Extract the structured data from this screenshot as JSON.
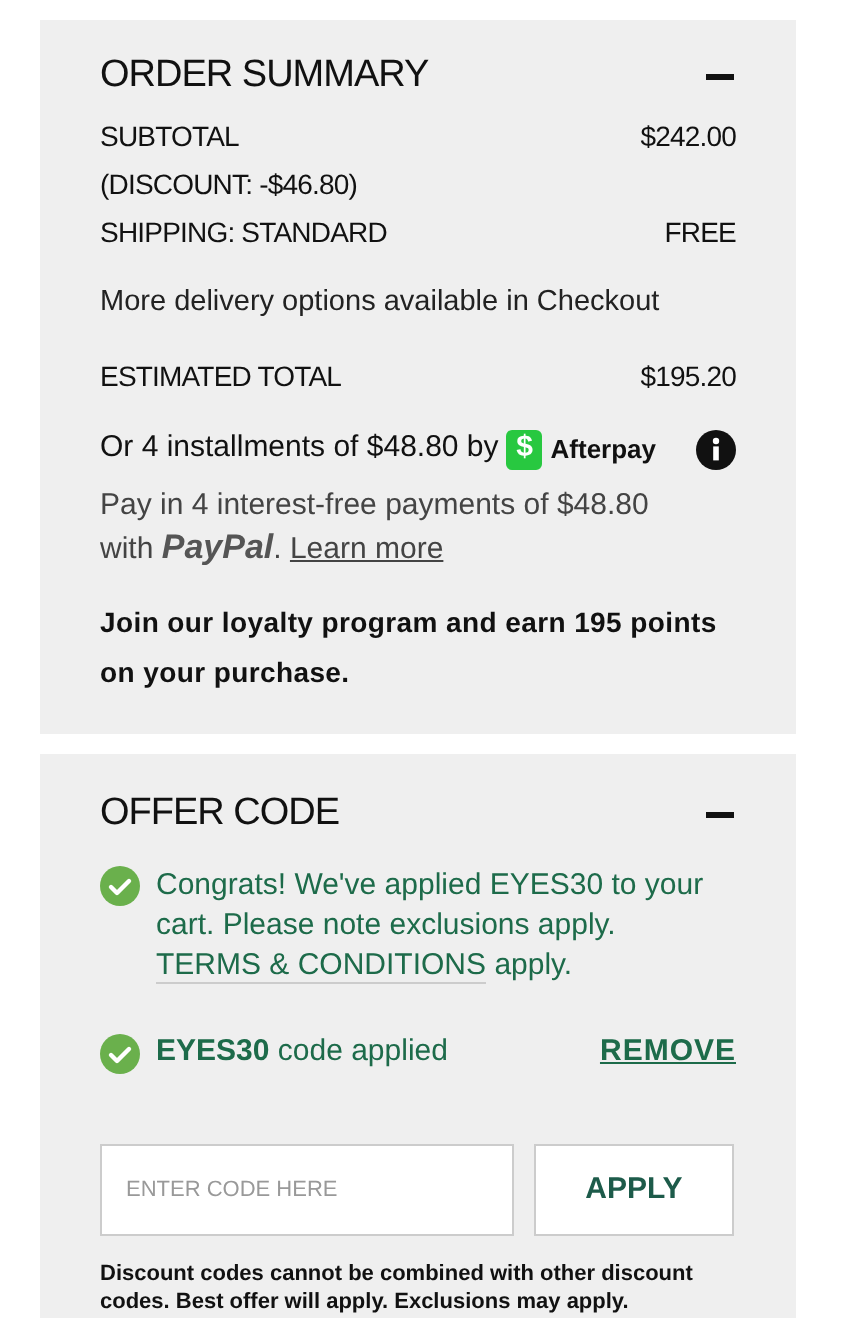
{
  "order_summary": {
    "title": "ORDER SUMMARY",
    "expanded": true,
    "lines": [
      {
        "label": "SUBTOTAL",
        "value": "$242.00"
      },
      {
        "label": "(DISCOUNT: -$46.80)"
      },
      {
        "label": "SHIPPING: STANDARD",
        "value": "FREE"
      }
    ],
    "delivery_note": "More delivery options available in Checkout",
    "total": {
      "label": "ESTIMATED TOTAL",
      "value": "$195.20"
    },
    "afterpay": {
      "text": "Or 4 installments of $48.80 by",
      "logo_glyph": "$",
      "brand": "Afterpay"
    },
    "paypal": {
      "text_before": "Pay in 4 interest-free payments of $48.80 with",
      "brand": "PayPal",
      "text_after": ".",
      "link": "Learn more"
    },
    "loyalty": "Join our loyalty program and earn 195 points on your purchase."
  },
  "offer_code": {
    "title": "OFFER CODE",
    "expanded": true,
    "message": {
      "text": "Congrats! We've applied EYES30 to your cart. Please note exclusions apply.",
      "link": "TERMS & CONDITIONS",
      "text_after": "apply."
    },
    "applied": {
      "code": "EYES30",
      "text": "code applied",
      "remove": "REMOVE"
    },
    "input": {
      "placeholder": "ENTER CODE HERE"
    },
    "apply_button": "APPLY",
    "disclaimer": "Discount codes cannot be combined with other discount codes. Best offer will apply. Exclusions may apply."
  }
}
